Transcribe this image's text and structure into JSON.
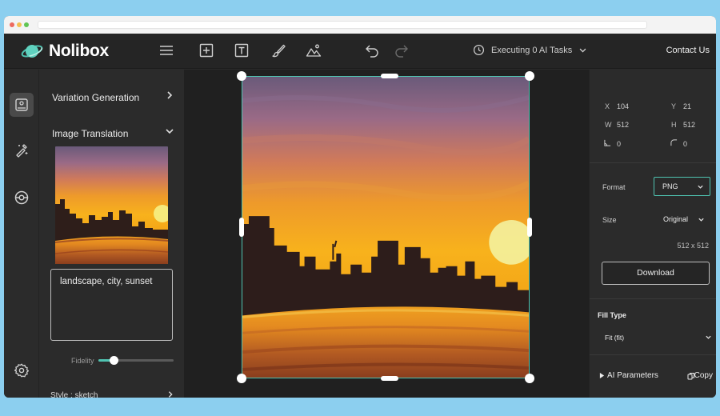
{
  "app": {
    "brand": "Nolibox"
  },
  "toolbar": {
    "menu_icon": "hamburger-icon",
    "add_icon": "add-square-icon",
    "text_icon": "text-tool-icon",
    "brush_icon": "brush-icon",
    "image_icon": "image-icon",
    "undo_icon": "undo-icon",
    "redo_icon": "redo-icon",
    "tasks_label": "Executing 0 AI Tasks",
    "contact_label": "Contact Us"
  },
  "rail": {
    "items": [
      "image-panel-icon",
      "magic-wand-icon",
      "sphere-icon",
      "settings-icon"
    ]
  },
  "left_panel": {
    "variation_label": "Variation Generation",
    "translation_label": "Image Translation",
    "prompt_text": "landscape, city, sunset",
    "fidelity_label": "Fidelity",
    "fidelity_value": 0.2,
    "style_label": "Style : sketch"
  },
  "properties": {
    "x_label": "X",
    "x_value": "104",
    "y_label": "Y",
    "y_value": "21",
    "w_label": "W",
    "w_value": "512",
    "h_label": "H",
    "h_value": "512",
    "skew_value": "0",
    "radius_value": "0",
    "format_label": "Format",
    "format_value": "PNG",
    "size_label": "Size",
    "size_value": "Original",
    "dimensions": "512 x 512",
    "download_label": "Download",
    "fill_type_label": "Fill Type",
    "fill_type_value": "Fit (fit)",
    "ai_params_label": "AI Parameters",
    "copy_label": "Copy"
  },
  "colors": {
    "accent": "#4fc3b1",
    "background": "#8ccfef",
    "panel": "#2b2b2b"
  }
}
